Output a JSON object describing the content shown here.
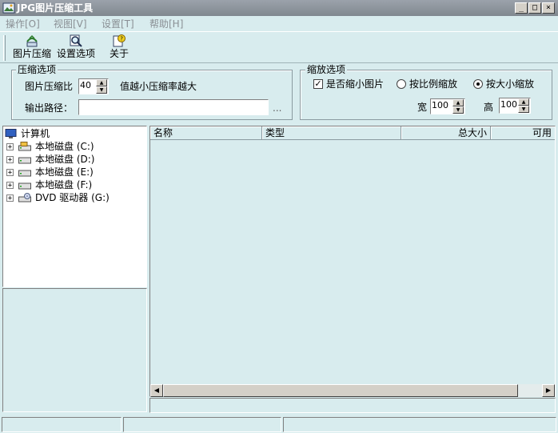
{
  "window": {
    "title": "JPG图片压缩工具",
    "min": "_",
    "max": "□",
    "close": "×"
  },
  "menu": [
    {
      "label": "操作[O]"
    },
    {
      "label": "视图[V]"
    },
    {
      "label": "设置[T]"
    },
    {
      "label": "帮助[H]"
    }
  ],
  "toolbar": {
    "compress": "图片压缩",
    "settings": "设置选项",
    "about": "关于"
  },
  "compress_group": {
    "legend": "压缩选项",
    "ratio_label": "图片压缩比",
    "ratio_value": "40",
    "ratio_hint": "值越小压缩率越大",
    "output_label": "输出路径：",
    "output_value": "",
    "browse": "..."
  },
  "scale_group": {
    "legend": "缩放选项",
    "shrink_label": "是否缩小图片",
    "shrink_checked": true,
    "by_ratio_label": "按比例缩放",
    "by_size_label": "按大小缩放",
    "selected_mode": "by_size",
    "width_label": "宽",
    "width_value": "100",
    "height_label": "高",
    "height_value": "100"
  },
  "tree": {
    "root": "计算机",
    "drives": [
      {
        "label": "本地磁盘 (C:)",
        "icon": "system-drive-icon"
      },
      {
        "label": "本地磁盘 (D:)",
        "icon": "hard-drive-icon"
      },
      {
        "label": "本地磁盘 (E:)",
        "icon": "hard-drive-icon"
      },
      {
        "label": "本地磁盘 (F:)",
        "icon": "hard-drive-icon"
      },
      {
        "label": "DVD 驱动器 (G:)",
        "icon": "dvd-drive-icon"
      }
    ]
  },
  "list": {
    "columns": [
      "名称",
      "类型",
      "总大小",
      "可用"
    ]
  }
}
